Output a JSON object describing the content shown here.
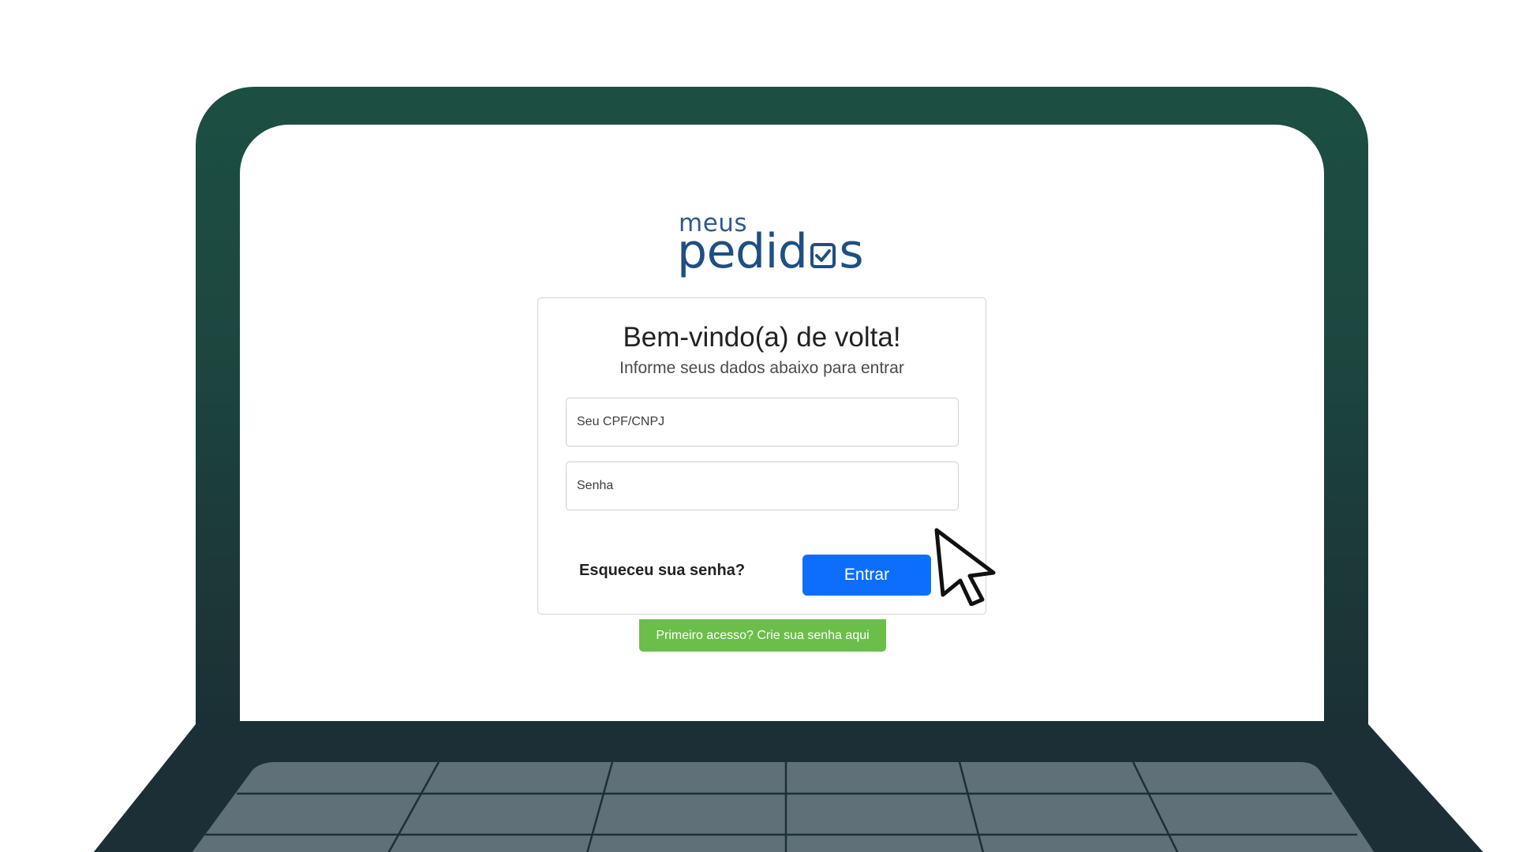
{
  "brand": {
    "logo_top": "meus",
    "logo_main_start": "pedid",
    "logo_main_end": "s",
    "logo_color": "#1f4f82"
  },
  "login": {
    "title": "Bem-vindo(a) de volta!",
    "subtitle": "Informe seus dados abaixo para entrar",
    "cpf_field": {
      "placeholder": "Seu CPF/CNPJ",
      "value": ""
    },
    "password_field": {
      "placeholder": "Senha",
      "value": ""
    },
    "forgot_password_label": "Esqueceu sua senha?",
    "submit_label": "Entrar",
    "first_access_label": "Primeiro acesso? Crie sua senha aqui"
  },
  "colors": {
    "primary_button": "#0d6efd",
    "first_access_button": "#6bbe4a",
    "laptop_frame": "#1c4f42",
    "laptop_base": "#1c2f36",
    "keyboard_keys": "#5f7079"
  },
  "icons": {
    "logo_check": "check-square-icon",
    "cursor": "mouse-pointer-icon"
  }
}
